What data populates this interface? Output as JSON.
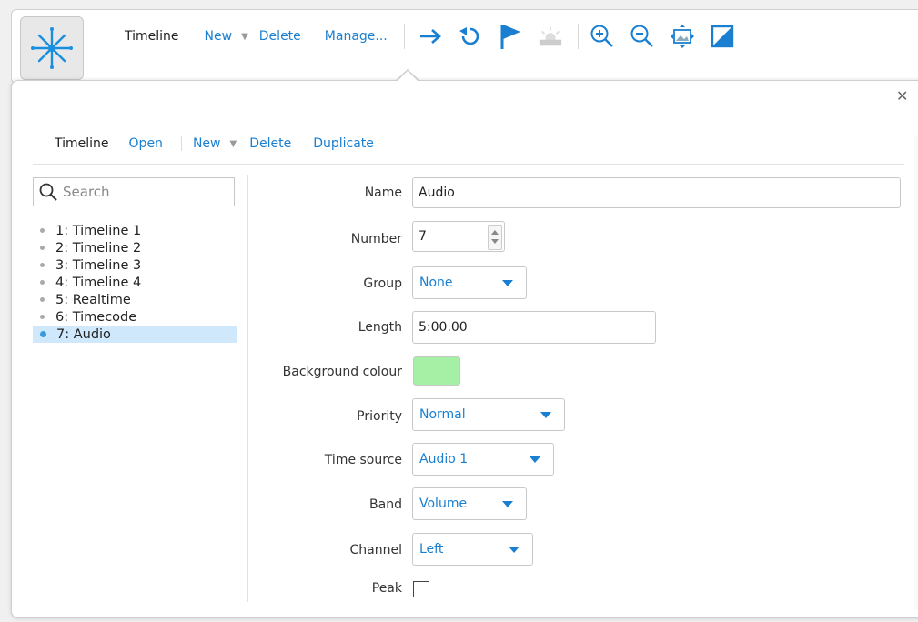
{
  "toolbar": {
    "title": "Timeline",
    "new": "New",
    "delete": "Delete",
    "manage": "Manage...",
    "icons": [
      "arrow-right-icon",
      "undo-icon",
      "flag-icon",
      "sunrise-icon",
      "zoom-in-icon",
      "zoom-out-icon",
      "fit-image-icon",
      "contrast-icon"
    ]
  },
  "panel": {
    "subbar": {
      "title": "Timeline",
      "open": "Open",
      "new": "New",
      "delete": "Delete",
      "duplicate": "Duplicate"
    },
    "search": {
      "placeholder": "Search"
    },
    "timelines": [
      {
        "label": "1: Timeline 1"
      },
      {
        "label": "2: Timeline 2"
      },
      {
        "label": "3: Timeline 3"
      },
      {
        "label": "4: Timeline 4"
      },
      {
        "label": "5: Realtime"
      },
      {
        "label": "6: Timecode"
      },
      {
        "label": "7: Audio",
        "selected": true
      }
    ],
    "form": {
      "name_label": "Name",
      "name_value": "Audio",
      "number_label": "Number",
      "number_value": "7",
      "group_label": "Group",
      "group_value": "None",
      "length_label": "Length",
      "length_value": "5:00.00",
      "bg_label": "Background colour",
      "bg_color": "#a6f0a6",
      "priority_label": "Priority",
      "priority_value": "Normal",
      "timesource_label": "Time source",
      "timesource_value": "Audio 1",
      "band_label": "Band",
      "band_value": "Volume",
      "channel_label": "Channel",
      "channel_value": "Left",
      "peak_label": "Peak",
      "peak_checked": false
    }
  },
  "colors": {
    "accent": "#1a7fd0",
    "selection": "#cfe8fb"
  }
}
